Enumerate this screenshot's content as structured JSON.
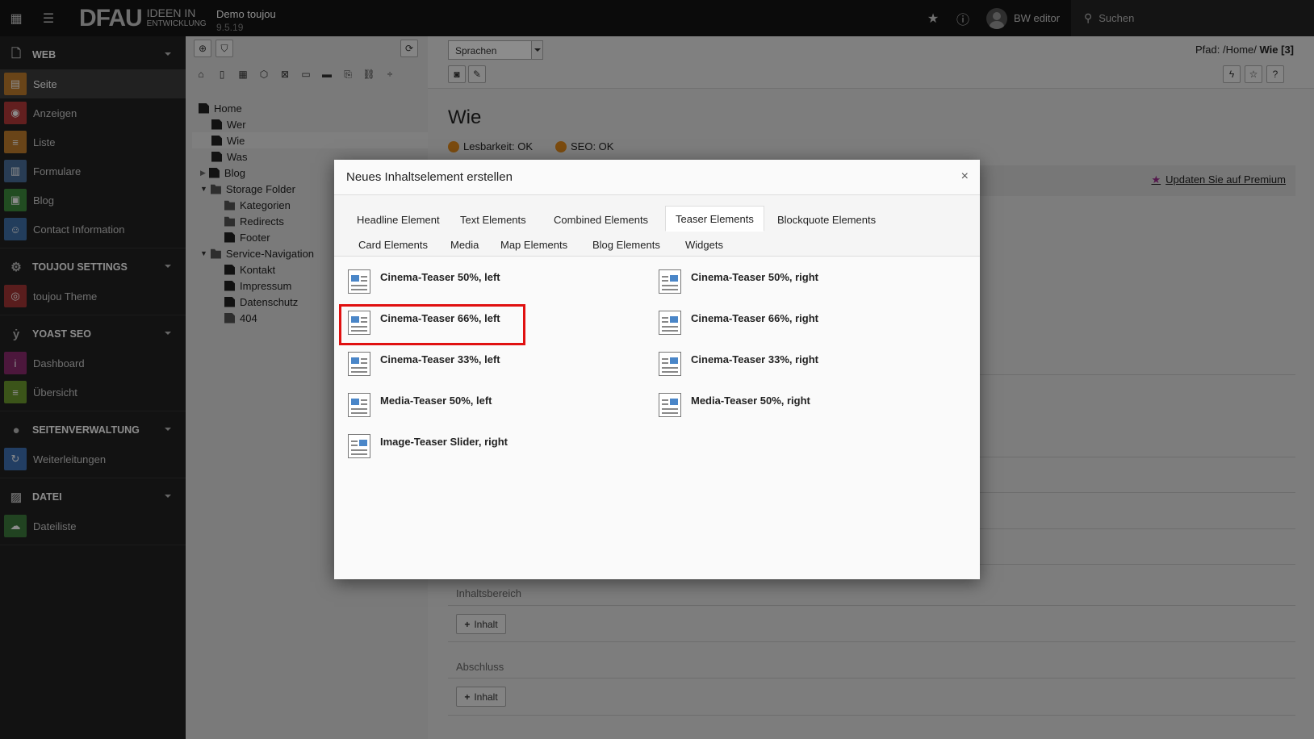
{
  "topbar": {
    "site_name": "Demo toujou",
    "version": "9.5.19",
    "logo_main": "DFAU",
    "logo_line1": "IDEEN IN",
    "logo_line2": "ENTWICKLUNG",
    "username": "BW editor",
    "search_placeholder": "Suchen"
  },
  "sidebar": {
    "groups": {
      "web": "WEB",
      "toujou": "TOUJOU SETTINGS",
      "yoast": "YOAST SEO",
      "seiten": "SEITENVERWALTUNG",
      "datei": "DATEI"
    },
    "items": {
      "seite": "Seite",
      "anzeigen": "Anzeigen",
      "liste": "Liste",
      "formulare": "Formulare",
      "blog": "Blog",
      "contact": "Contact Information",
      "theme": "toujou Theme",
      "dashboard": "Dashboard",
      "uebersicht": "Übersicht",
      "weiterleitungen": "Weiterleitungen",
      "dateiliste": "Dateiliste"
    },
    "colors": {
      "seite": "#c07c2c",
      "anzeigen": "#b23a3a",
      "liste": "#c07c2c",
      "formulare": "#4a6e9a",
      "blog": "#3d8b3d",
      "contact": "#3f6fa8",
      "theme": "#a33636",
      "dashboard": "#8a2a6e",
      "uebersicht": "#6c9a2e",
      "weiterleitungen": "#3f72b5",
      "dateiliste": "#3d7a3d"
    }
  },
  "tree": {
    "home": "Home",
    "wer": "Wer",
    "wie": "Wie",
    "was": "Was",
    "blog": "Blog",
    "storage": "Storage Folder",
    "kategorien": "Kategorien",
    "redirects": "Redirects",
    "footer": "Footer",
    "service": "Service-Navigation",
    "kontakt": "Kontakt",
    "impressum": "Impressum",
    "datenschutz": "Datenschutz",
    "p404": "404"
  },
  "content": {
    "language_select": "Sprachen",
    "path_label": "Pfad: /Home/",
    "path_current": "Wie [3]",
    "page_title": "Wie",
    "readability": "Lesbarkeit: OK",
    "seo": "SEO: OK",
    "premium_link": "Updaten Sie auf Premium",
    "section_inhalt": "Inhaltsbereich",
    "section_abschluss": "Abschluss",
    "add_content_button": "Inhalt"
  },
  "modal": {
    "title": "Neues Inhaltselement erstellen",
    "close": "×",
    "tabs": [
      "Headline Element",
      "Text Elements",
      "Combined Elements",
      "Teaser Elements",
      "Blockquote Elements",
      "Card Elements",
      "Media",
      "Map Elements",
      "Blog Elements",
      "Widgets"
    ],
    "active_tab": "Teaser Elements",
    "items_left": [
      "Cinema-Teaser 50%, left",
      "Cinema-Teaser 66%, left",
      "Cinema-Teaser 33%, left",
      "Media-Teaser 50%, left",
      "Image-Teaser Slider, right"
    ],
    "items_right": [
      "Cinema-Teaser 50%, right",
      "Cinema-Teaser 66%, right",
      "Cinema-Teaser 33%, right",
      "Media-Teaser 50%, right"
    ],
    "highlighted_item": "Cinema-Teaser 66%, left",
    "highlight_color": "#e01010"
  }
}
